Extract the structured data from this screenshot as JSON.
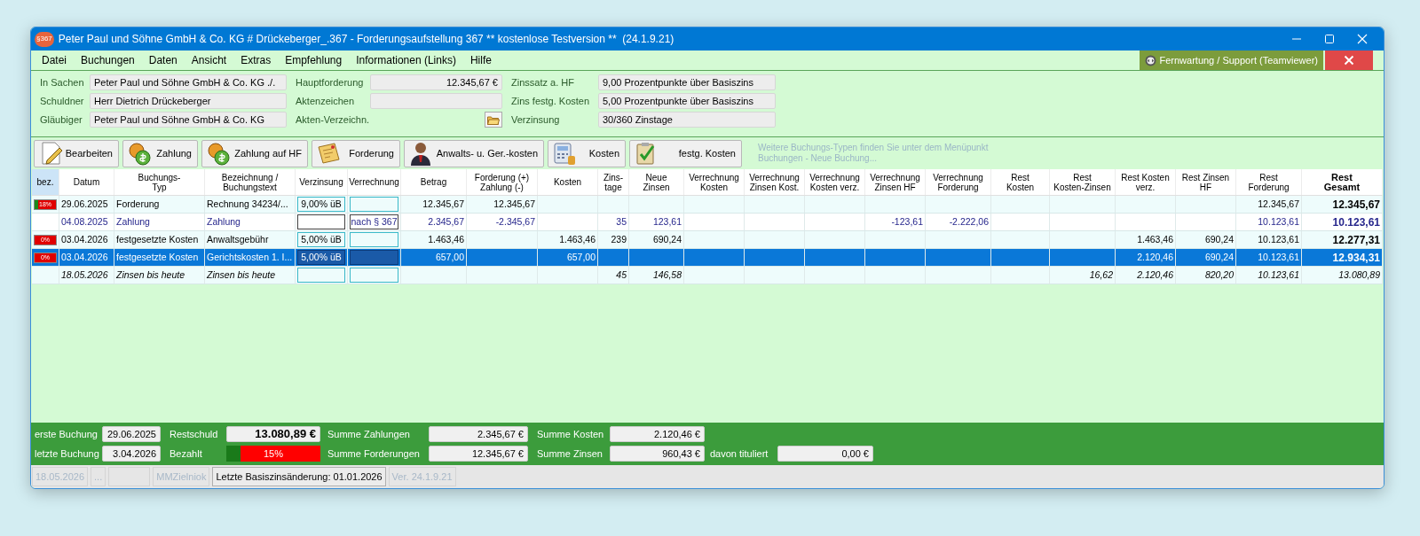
{
  "window": {
    "icon_label": "§367",
    "title": "Peter Paul und Söhne GmbH & Co. KG # Drückeberger_.367 - Forderungsaufstellung 367 ** kostenlose Testversion **  (24.1.9.21)"
  },
  "menu": [
    "Datei",
    "Buchungen",
    "Daten",
    "Ansicht",
    "Extras",
    "Empfehlung",
    "Informationen (Links)",
    "Hilfe"
  ],
  "support_button": "Fernwartung / Support (Teamviewer)",
  "header": [
    {
      "label": "In Sachen",
      "value": "Peter Paul und Söhne GmbH & Co. KG ./."
    },
    {
      "label": "Schuldner",
      "value": "Herr Dietrich Drückeberger"
    },
    {
      "label": "Gläubiger",
      "value": "Peter Paul und Söhne GmbH & Co. KG"
    },
    {
      "label": "Hauptforderung",
      "value": "12.345,67 €"
    },
    {
      "label": "Aktenzeichen"
    },
    {
      "label": "Akten-Verzeichn.",
      "kind": "folder"
    },
    {
      "label": "Zinssatz a. HF",
      "value": "9,00 Prozentpunkte über Basiszins"
    },
    {
      "label": "Zins festg. Kosten",
      "value": "5,00 Prozentpunkte über Basiszins"
    },
    {
      "label": "Verzinsung",
      "value": "30/360 Zinstage"
    }
  ],
  "toolbar": [
    "Bearbeiten",
    "Zahlung",
    "Zahlung auf HF",
    "Forderung",
    "Anwalts- u. Ger.-kosten",
    "Kosten",
    "festg. Kosten"
  ],
  "toolbar_hint": "Weitere Buchungs-Typen finden Sie unter dem Menüpunkt\nBuchungen - Neue Buchung...",
  "table": {
    "columns": [
      {
        "label": "bez.",
        "kind": "badge",
        "highlighted": true
      },
      {
        "label": "Datum",
        "kind": "text"
      },
      {
        "label": "Buchungs-\nTyp",
        "kind": "text"
      },
      {
        "label": "Bezeichnung /\nBuchungstext",
        "kind": "text"
      },
      {
        "label": "Verzinsung",
        "kind": "field"
      },
      {
        "label": "Verrechnung",
        "kind": "field"
      },
      {
        "label": "Betrag",
        "kind": "number"
      },
      {
        "label": "Forderung (+)\nZahlung (-)",
        "kind": "number"
      },
      {
        "label": "Kosten",
        "kind": "number"
      },
      {
        "label": "Zins-\ntage",
        "kind": "number"
      },
      {
        "label": "Neue\nZinsen",
        "kind": "number"
      },
      {
        "label": "Verrechnung\nKosten",
        "kind": "number"
      },
      {
        "label": "Verrechnung\nZinsen Kost.",
        "kind": "number"
      },
      {
        "label": "Verrechnung\nKosten verz.",
        "kind": "number"
      },
      {
        "label": "Verrechnung\nZinsen HF",
        "kind": "number"
      },
      {
        "label": "Verrechnung\nForderung",
        "kind": "number"
      },
      {
        "label": "Rest\nKosten",
        "kind": "number"
      },
      {
        "label": "Rest\nKosten-Zinsen",
        "kind": "number"
      },
      {
        "label": "Rest Kosten\nverz.",
        "kind": "number"
      },
      {
        "label": "Rest Zinsen\nHF",
        "kind": "number"
      },
      {
        "label": "Rest\nForderung",
        "kind": "number"
      },
      {
        "label": "Rest\nGesamt",
        "kind": "number",
        "bold": true
      }
    ],
    "rows": [
      {
        "kind": "claim",
        "selected": false,
        "cells": [
          {
            "text": "18%",
            "level": 0.18
          },
          "29.06.2025",
          "Forderung",
          "Rechnung 34234/...",
          "9,00% üB",
          "",
          "12.345,67",
          "12.345,67",
          "",
          "",
          "",
          "",
          "",
          "",
          "",
          "",
          "",
          "",
          "",
          "",
          "12.345,67",
          "12.345,67"
        ]
      },
      {
        "kind": "payment",
        "selected": false,
        "cells": [
          "",
          "04.08.2025",
          "Zahlung",
          "Zahlung",
          "",
          "nach § 367",
          "2.345,67",
          "-2.345,67",
          "",
          "35",
          "123,61",
          "",
          "",
          "",
          "-123,61",
          "-2.222,06",
          "",
          "",
          "",
          "",
          "10.123,61",
          "10.123,61"
        ]
      },
      {
        "kind": "claim",
        "selected": false,
        "cells": [
          {
            "text": "0%",
            "level": 0
          },
          "03.04.2026",
          "festgesetzte Kosten",
          "Anwaltsgebühr",
          "5,00% üB",
          "",
          "1.463,46",
          "",
          "1.463,46",
          "239",
          "690,24",
          "",
          "",
          "",
          "",
          "",
          "",
          "",
          "1.463,46",
          "690,24",
          "10.123,61",
          "12.277,31"
        ]
      },
      {
        "kind": "claim",
        "selected": true,
        "cells": [
          {
            "text": "0%",
            "level": 0
          },
          "03.04.2026",
          "festgesetzte Kosten",
          "Gerichtskosten 1. I...",
          "5,00% üB",
          "",
          "657,00",
          "",
          "657,00",
          "",
          "",
          "",
          "",
          "",
          "",
          "",
          "",
          "",
          "2.120,46",
          "690,24",
          "10.123,61",
          "12.934,31"
        ]
      },
      {
        "kind": "summary",
        "selected": false,
        "cells": [
          "",
          "18.05.2026",
          "Zinsen bis heute",
          "Zinsen bis heute",
          "",
          "",
          "",
          "",
          "",
          "45",
          "146,58",
          "",
          "",
          "",
          "",
          "",
          "",
          "16,62",
          "2.120,46",
          "820,20",
          "10.123,61",
          "13.080,89"
        ]
      }
    ]
  },
  "totals": {
    "first_booking": {
      "label": "erste Buchung",
      "value": "29.06.2025"
    },
    "last_booking": {
      "label": "letzte Buchung",
      "value": "3.04.2026"
    },
    "balance": {
      "label": "Restschuld",
      "value": "13.080,89 €"
    },
    "paid": {
      "label": "Bezahlt",
      "text": "15%",
      "level": 0.15
    },
    "payments": {
      "label": "Summe Zahlungen",
      "value": "2.345,67 €"
    },
    "claims": {
      "label": "Summe Forderungen",
      "value": "12.345,67 €"
    },
    "costs": {
      "label": "Summe Kosten",
      "value": "2.120,46 €"
    },
    "interest": {
      "label": "Summe Zinsen",
      "value": "960,43 €"
    },
    "titled": {
      "label": "davon tituliert",
      "value": "0,00 €"
    }
  },
  "status_bar": [
    {
      "text": "18.05.2026",
      "disabled": true
    },
    {
      "text": "...",
      "disabled": true
    },
    {
      "disabled": true
    },
    {
      "text": "MMZielniok",
      "disabled": true
    },
    {
      "text": "Letzte Basiszinsänderung: 01.01.2026",
      "disabled": false
    },
    {
      "text": "Ver. 24.1.9.21",
      "disabled": true
    }
  ]
}
